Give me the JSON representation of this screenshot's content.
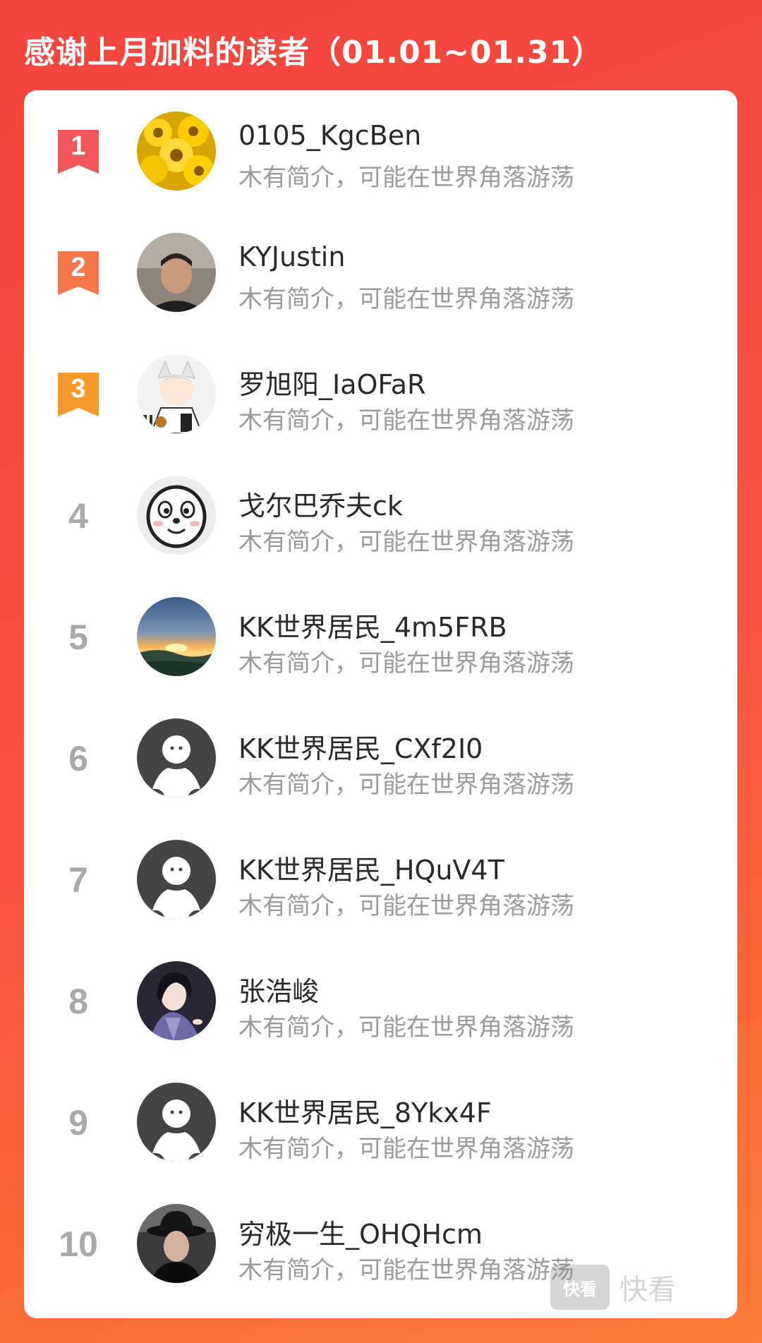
{
  "header": {
    "title": "感谢上月加料的读者（01.01~01.31）"
  },
  "readers": [
    {
      "rank": "1",
      "name": "0105_KgcBen",
      "bio": "木有简介，可能在世界角落游荡",
      "avatar": "sunflower-avatar",
      "badge_color": "#f5555d"
    },
    {
      "rank": "2",
      "name": "KYJustin",
      "bio": "木有简介，可能在世界角落游荡",
      "avatar": "photo-avatar",
      "badge_color": "#f7774a"
    },
    {
      "rank": "3",
      "name": "罗旭阳_IaOFaR",
      "bio": "木有简介，可能在世界角落游荡",
      "avatar": "anime-avatar",
      "badge_color": "#f79a2a"
    },
    {
      "rank": "4",
      "name": "戈尔巴乔夫ck",
      "bio": "木有简介，可能在世界角落游荡",
      "avatar": "cartoon-face-avatar"
    },
    {
      "rank": "5",
      "name": "KK世界居民_4m5FRB",
      "bio": "木有简介，可能在世界角落游荡",
      "avatar": "sunset-avatar"
    },
    {
      "rank": "6",
      "name": "KK世界居民_CXf2I0",
      "bio": "木有简介，可能在世界角落游荡",
      "avatar": "default-avatar"
    },
    {
      "rank": "7",
      "name": "KK世界居民_HQuV4T",
      "bio": "木有简介，可能在世界角落游荡",
      "avatar": "default-avatar"
    },
    {
      "rank": "8",
      "name": "张浩峻",
      "bio": "木有简介，可能在世界角落游荡",
      "avatar": "anime-avatar-dark"
    },
    {
      "rank": "9",
      "name": "KK世界居民_8Ykx4F",
      "bio": "木有简介，可能在世界角落游荡",
      "avatar": "default-avatar"
    },
    {
      "rank": "10",
      "name": "穷极一生_OHQHcm",
      "bio": "木有简介，可能在世界角落游荡",
      "avatar": "hat-photo-avatar"
    }
  ],
  "watermark": {
    "logo_text": "快看",
    "text": "快看"
  }
}
